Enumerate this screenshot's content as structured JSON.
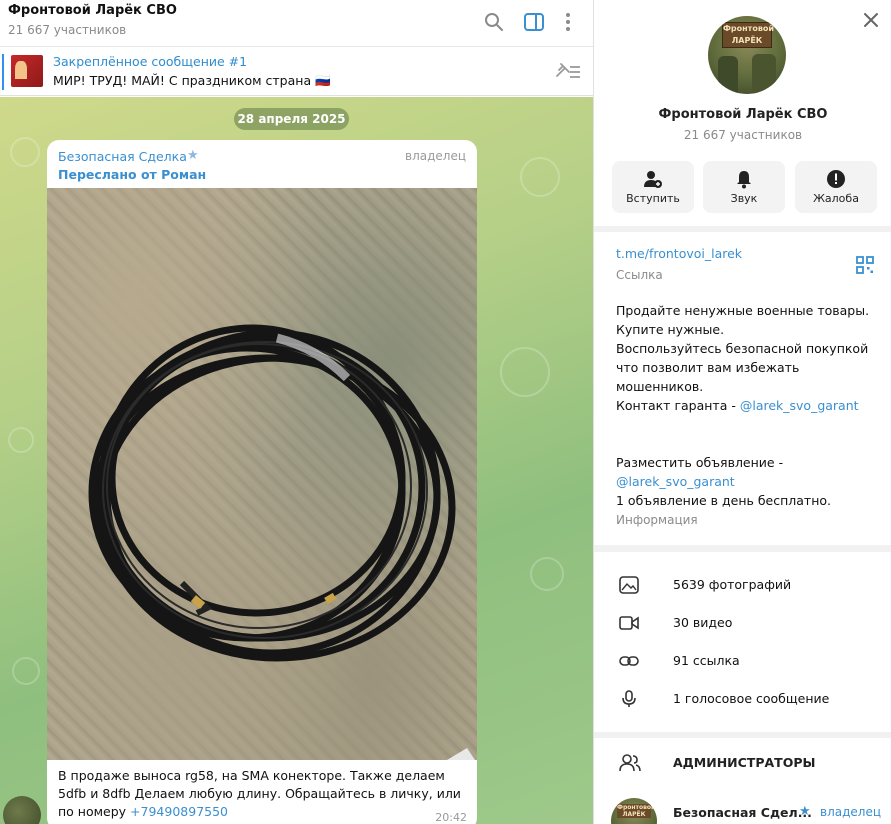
{
  "chat": {
    "title": "Фронтовой Ларёк СВО",
    "subtitle": "21 667 участников",
    "header_icons": [
      "search-icon",
      "sidebar-toggle-icon",
      "more-vertical-icon"
    ],
    "pinned": {
      "title": "Закреплённое сообщение #1",
      "text": "МИР! ТРУД! МАЙ!  С праздником страна 🇷🇺"
    },
    "date": "28 апреля 2025",
    "message": {
      "author": "Безопасная Сделка",
      "star": "★",
      "role": "владелец",
      "forwarded": "Переслано от Роман",
      "text": "В продаже выноса rg58, на SMA конекторе. Также  делаем 5dfb и 8dfb Делаем любую длину. Обращайтесь в личку, или по номеру ",
      "phone": "+79490897550",
      "time": "20:42"
    }
  },
  "panel": {
    "name": "Фронтовой Ларёк СВО",
    "members": "21 667 участников",
    "actions": [
      {
        "label": "Вступить",
        "icon": "join-user-icon"
      },
      {
        "label": "Звук",
        "icon": "bell-icon"
      },
      {
        "label": "Жалоба",
        "icon": "report-icon"
      }
    ],
    "info": {
      "link": "t.me/frontovoi_larek",
      "link_label": "Ссылка",
      "desc1": "Продайте ненужные военные товары.\nКупите нужные.\nВоспользуйтесь безопасной покупкой что позволит вам избежать мошенников.\nКонтакт гаранта - ",
      "desc1_link": "@larek_svo_garant",
      "desc2": "Разместить объявление - ",
      "desc2_link": "@larek_svo_garant",
      "desc3": "1 объявление в день бесплатно.",
      "label": "Информация"
    },
    "media": [
      {
        "text": "5639 фотографий",
        "icon": "photo-icon"
      },
      {
        "text": "30 видео",
        "icon": "video-icon"
      },
      {
        "text": "91 ссылка",
        "icon": "link-icon"
      },
      {
        "text": "1 голосовое сообщение",
        "icon": "microphone-icon"
      }
    ],
    "admins": {
      "title": "АДМИНИСТРАТОРЫ",
      "admin_name": "Безопасная Сдел...",
      "admin_star": "★",
      "admin_role": "владелец"
    },
    "avatar_sign": "Фронтовой ЛАРЁК"
  }
}
